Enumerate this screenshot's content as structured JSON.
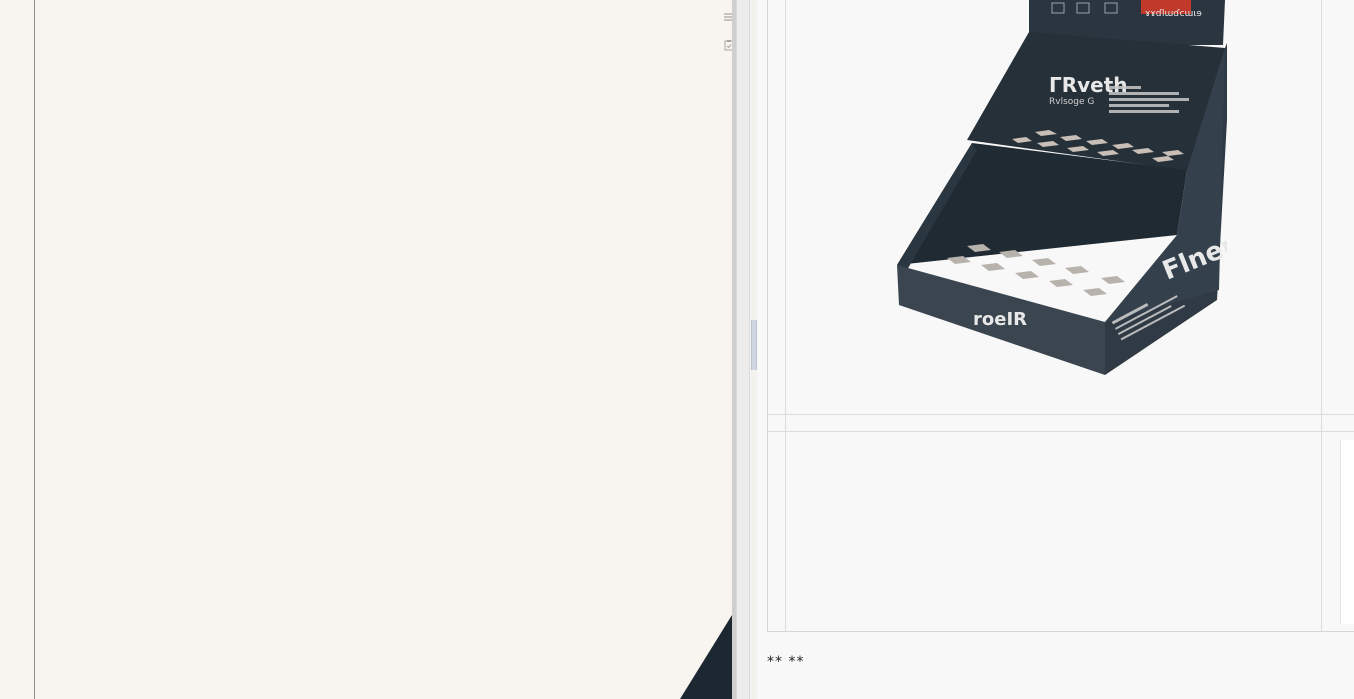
{
  "left_pane": {
    "icons": [
      "list-icon",
      "clipboard-check-icon"
    ]
  },
  "right_pane": {
    "product_image": {
      "subject": "cardboard-countertop-display-stand",
      "colors": {
        "box": "#2b3540",
        "accent": "#c0392b",
        "text": "#e8e8e8"
      },
      "printed_text": {
        "header_label": "ɤɤɗlɯɗcɯɩɘ",
        "back_title": "ГRveth",
        "back_subtitle": "Rvlsoge G",
        "side_brand": "Flner",
        "front_label": "roeIR"
      }
    },
    "footer_text": "** **"
  },
  "colors": {
    "left_background": "#f8f4ef",
    "right_background": "#f8f8f8",
    "thumbnail_accent": "#e0b742"
  }
}
